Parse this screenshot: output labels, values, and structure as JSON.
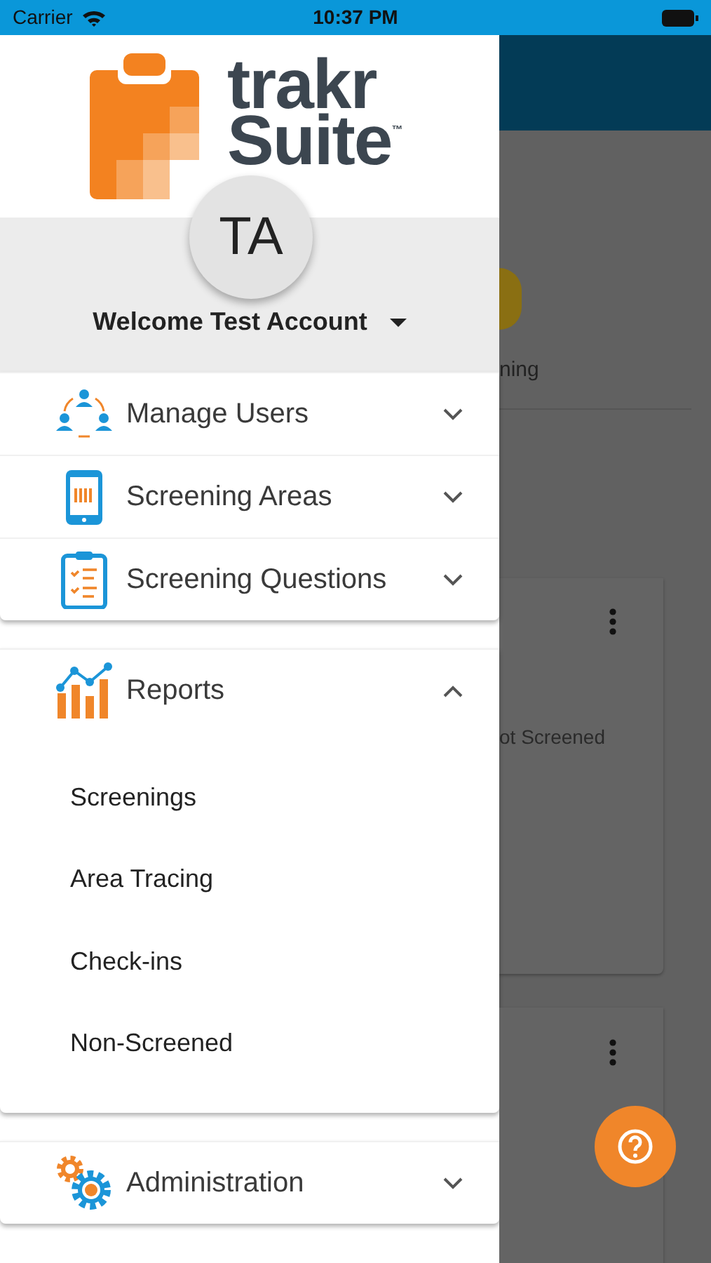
{
  "status_bar": {
    "carrier": "Carrier",
    "time": "10:37 PM"
  },
  "logo": {
    "line_1": "trakr",
    "line_2": "Suite",
    "mark": "™"
  },
  "profile": {
    "initials": "TA",
    "welcome": "Welcome Test Account"
  },
  "menu_groups": [
    {
      "items": [
        {
          "label": "Manage Users",
          "expanded": false
        },
        {
          "label": "Screening Areas",
          "expanded": false
        },
        {
          "label": "Screening Questions",
          "expanded": false
        }
      ]
    },
    {
      "items": [
        {
          "label": "Reports",
          "expanded": true,
          "children": [
            {
              "label": "Screenings"
            },
            {
              "label": "Area Tracing"
            },
            {
              "label": "Check-ins"
            },
            {
              "label": "Non-Screened"
            }
          ]
        }
      ]
    },
    {
      "items": [
        {
          "label": "Administration",
          "expanded": false
        }
      ]
    }
  ],
  "background": {
    "label_1": "ning",
    "label_2": "ot Screened"
  }
}
